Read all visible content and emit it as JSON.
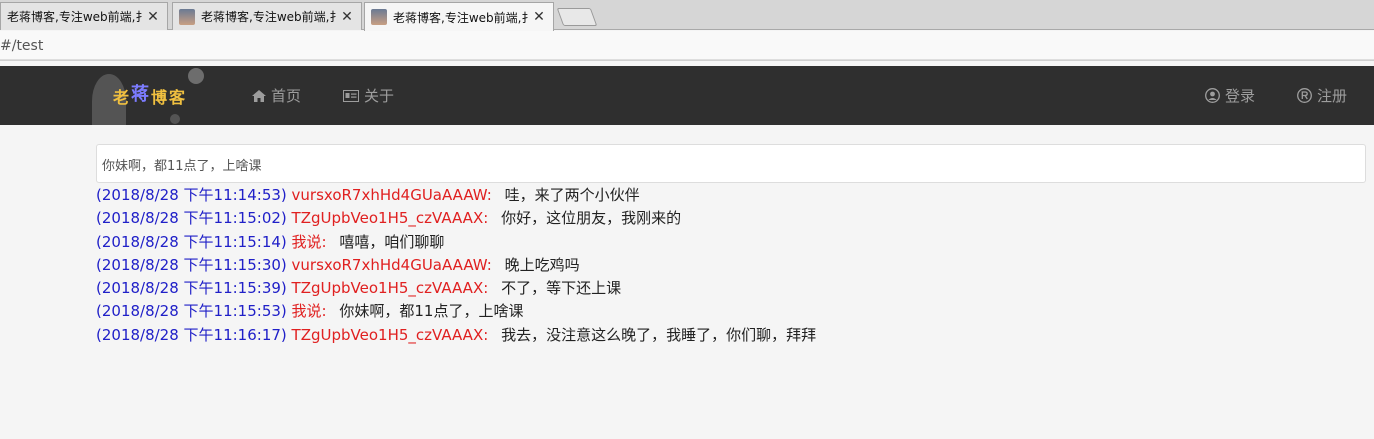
{
  "browser": {
    "tabs": [
      {
        "title": "老蒋博客,专注web前端,扌",
        "active": false
      },
      {
        "title": "老蒋博客,专注web前端,扌",
        "active": false
      },
      {
        "title": "老蒋博客,专注web前端,扌",
        "active": true
      }
    ],
    "close_glyph": "✕",
    "url": "#/test"
  },
  "navbar": {
    "logo": {
      "c1": "老",
      "c2": "蒋",
      "c3": "博",
      "c4": "客"
    },
    "links": [
      {
        "label": "首页",
        "icon": "home-icon"
      },
      {
        "label": "关于",
        "icon": "id-card-icon"
      }
    ],
    "right_links": [
      {
        "label": "登录",
        "icon": "user-circle-icon"
      },
      {
        "label": "注册",
        "icon": "registered-icon"
      }
    ]
  },
  "input": {
    "value": "你妹啊，都11点了，上啥课"
  },
  "chat": {
    "messages": [
      {
        "time": "(2018/8/28 下午11:14:53)",
        "user": "vursxoR7xhHd4GUaAAAW:",
        "text": "哇，来了两个小伙伴"
      },
      {
        "time": "(2018/8/28 下午11:15:02)",
        "user": "TZgUpbVeo1H5_czVAAAX:",
        "text": "你好，这位朋友，我刚来的"
      },
      {
        "time": "(2018/8/28 下午11:15:14)",
        "user": "我说:",
        "text": "嘻嘻，咱们聊聊"
      },
      {
        "time": "(2018/8/28 下午11:15:30)",
        "user": "vursxoR7xhHd4GUaAAAW:",
        "text": "晚上吃鸡吗"
      },
      {
        "time": "(2018/8/28 下午11:15:39)",
        "user": "TZgUpbVeo1H5_czVAAAX:",
        "text": "不了，等下还上课"
      },
      {
        "time": "(2018/8/28 下午11:15:53)",
        "user": "我说:",
        "text": "你妹啊，都11点了，上啥课"
      },
      {
        "time": "(2018/8/28 下午11:16:17)",
        "user": "TZgUpbVeo1H5_czVAAAX:",
        "text": "我去，没注意这么晚了，我睡了，你们聊，拜拜"
      }
    ]
  },
  "colors": {
    "navbar": "#2f2f2f",
    "time": "#2020c8",
    "user": "#e02020"
  }
}
